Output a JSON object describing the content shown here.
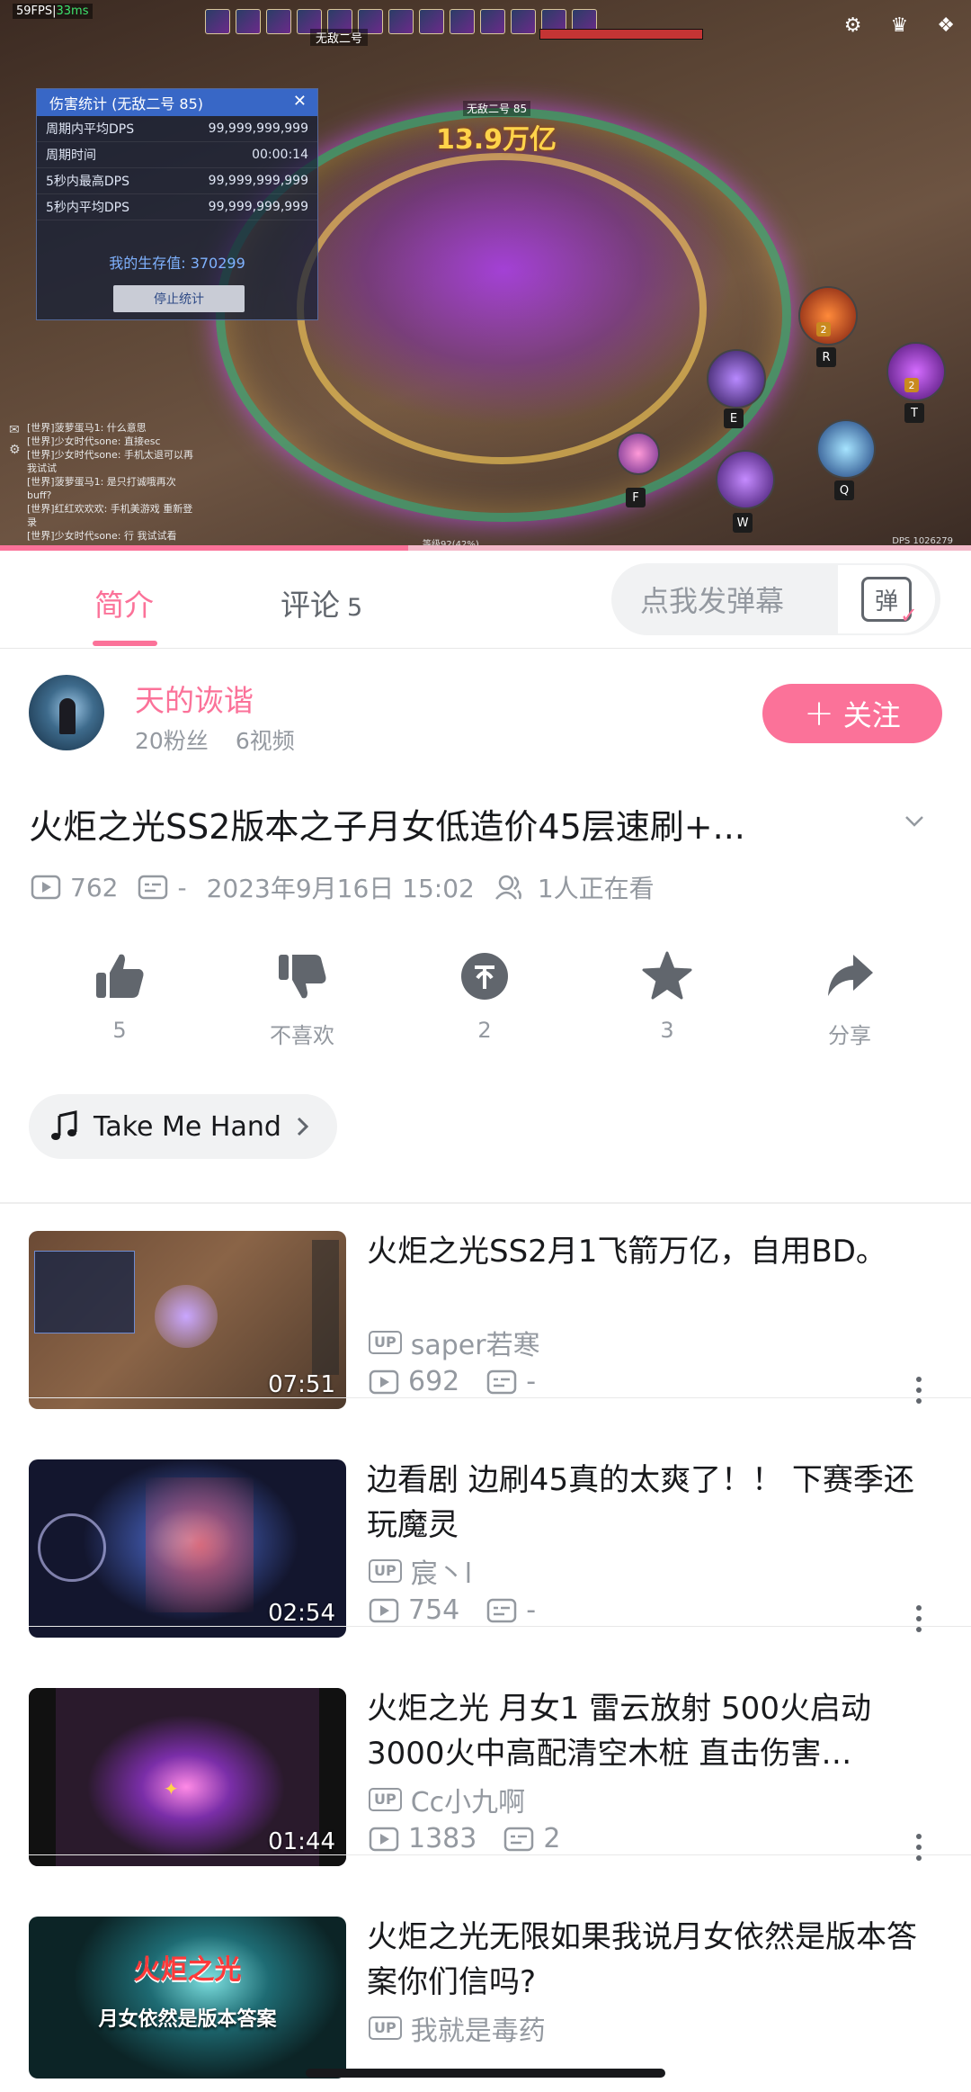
{
  "player": {
    "fps": "59FPS",
    "latency": "33ms",
    "boss_top_name": "无敌二号",
    "boss_label": "无敌二号 85",
    "damage_popup": "13.9万亿",
    "dps_panel": {
      "title": "伤害统计 (无敌二号 85)",
      "close": "✕",
      "rows": [
        {
          "label": "周期内平均DPS",
          "value": "99,999,999,999"
        },
        {
          "label": "周期时间",
          "value": "00:00:14"
        },
        {
          "label": "5秒内最高DPS",
          "value": "99,999,999,999"
        },
        {
          "label": "5秒内平均DPS",
          "value": "99,999,999,999"
        }
      ],
      "survival": "我的生存值: 370299",
      "stop_button": "停止统计"
    },
    "chat_lines": [
      "[世界]菠萝蛋马1: 什么意思",
      "[世界]少女时代sone: 直接esc",
      "[世界]少女时代sone: 手机太退可以再",
      "我试试",
      "[世界]菠萝蛋马1: 是只打诚哦再次",
      "buff?",
      "[世界]红红欢欢欢: 手机美游戏 重新登",
      "录",
      "[世界]少女时代sone: 行 我试试看"
    ],
    "skill_keys": [
      "R",
      "T",
      "E",
      "Q",
      "F",
      "W"
    ],
    "skill_charges": [
      "2",
      "2"
    ],
    "exp_text": "等级92(42%)",
    "dps_readout": "DPS 1026279",
    "progress": 0.42
  },
  "tabs": {
    "intro": "简介",
    "comments": "评论",
    "comments_count": "5",
    "danmaku_placeholder": "点我发弹幕",
    "danmaku_toggle": "弹"
  },
  "uploader": {
    "name": "天的诙谐",
    "fans": "20粉丝",
    "videos": "6视频",
    "follow_label": "关注"
  },
  "video": {
    "title": "火炬之光SS2版本之子月女低造价45层速刷+...",
    "views": "762",
    "danmaku": "-",
    "date": "2023年9月16日 15:02",
    "watching": "1人正在看"
  },
  "actions": {
    "like": "5",
    "dislike": "不喜欢",
    "coin": "2",
    "favorite": "3",
    "share": "分享"
  },
  "music": {
    "title": "Take Me Hand"
  },
  "related": [
    {
      "title": "火炬之光SS2月1飞箭万亿，自用BD。",
      "up": "saper若寒",
      "views": "692",
      "danmaku": "-",
      "duration": "07:51"
    },
    {
      "title": "边看剧 边刷45真的太爽了！！ 下赛季还玩魔灵",
      "up": "宸丶l",
      "views": "754",
      "danmaku": "-",
      "duration": "02:54"
    },
    {
      "title": "火炬之光 月女1 雷云放射 500火启动3000火中高配清空木桩 直击伤害…",
      "up": "Cc小九啊",
      "views": "1383",
      "danmaku": "2",
      "duration": "01:44"
    },
    {
      "title": "火炬之光无限如果我说月女依然是版本答案你们信吗?",
      "up": "我就是毒药",
      "views": "",
      "danmaku": "",
      "duration": "",
      "thumb_text_1": "火炬之光",
      "thumb_text_2": "月女依然是版本答案"
    }
  ],
  "colors": {
    "accent": "#fb7299",
    "text_primary": "#18191c",
    "text_secondary": "#9499a0"
  }
}
